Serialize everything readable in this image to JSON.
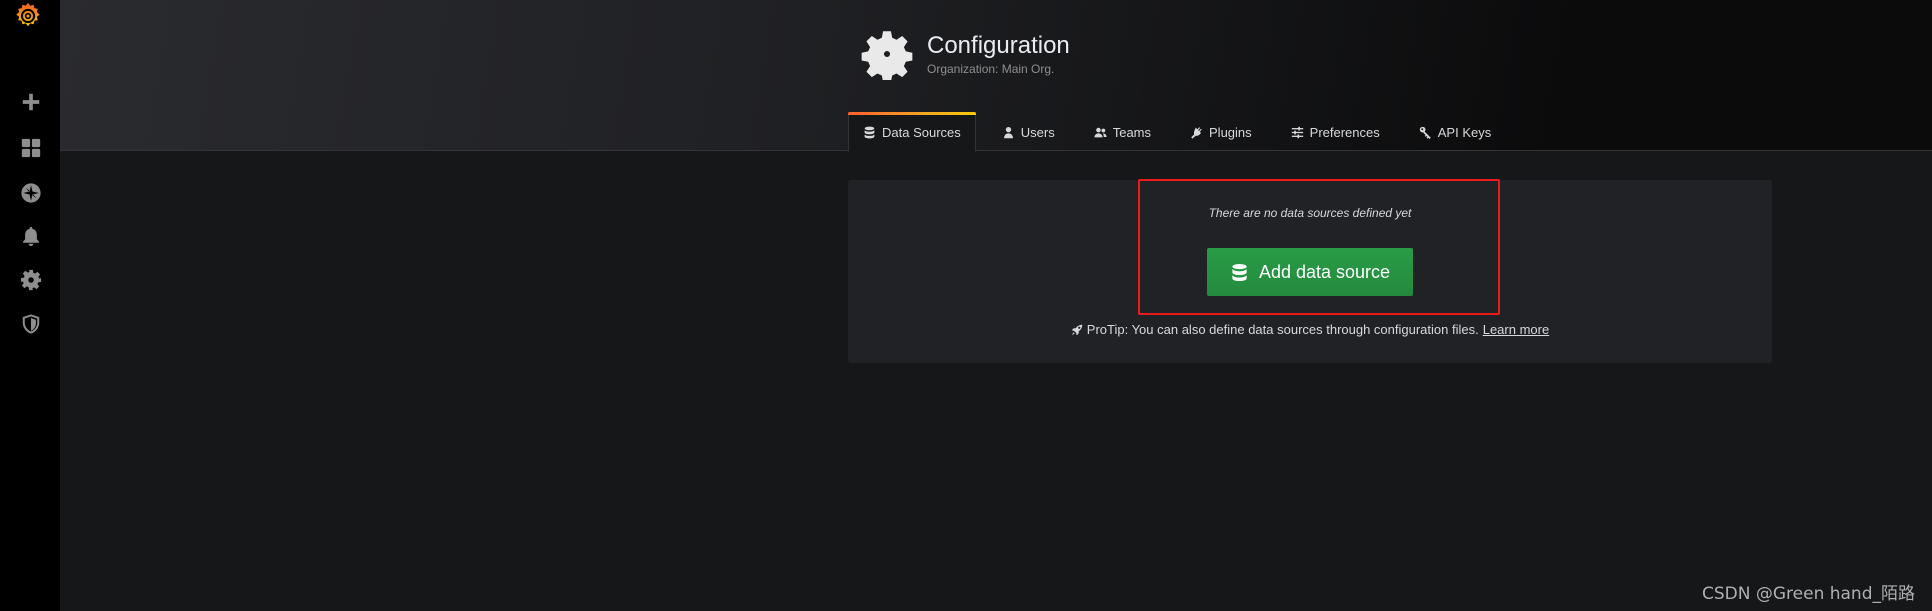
{
  "sidebar": {
    "logo": "grafana-logo",
    "items": [
      {
        "name": "create",
        "icon": "plus-icon"
      },
      {
        "name": "dashboards",
        "icon": "dashboards-grid-icon"
      },
      {
        "name": "explore",
        "icon": "compass-icon"
      },
      {
        "name": "alerting",
        "icon": "bell-icon"
      },
      {
        "name": "configuration",
        "icon": "gear-icon"
      },
      {
        "name": "server-admin",
        "icon": "shield-icon"
      }
    ]
  },
  "header": {
    "icon": "gear-icon",
    "title": "Configuration",
    "subtitle": "Organization: Main Org."
  },
  "tabs": [
    {
      "label": "Data Sources",
      "icon": "database-icon",
      "active": true
    },
    {
      "label": "Users",
      "icon": "user-icon",
      "active": false
    },
    {
      "label": "Teams",
      "icon": "users-icon",
      "active": false
    },
    {
      "label": "Plugins",
      "icon": "plug-icon",
      "active": false
    },
    {
      "label": "Preferences",
      "icon": "sliders-icon",
      "active": false
    },
    {
      "label": "API Keys",
      "icon": "key-icon",
      "active": false
    }
  ],
  "empty_state": {
    "message": "There are no data sources defined yet",
    "button_label": "Add data source",
    "protip": "ProTip: You can also define data sources through configuration files.",
    "learn_more": "Learn more"
  },
  "colors": {
    "accent_green": "#299c46",
    "highlight_red": "#ec1c1c",
    "tab_gradient_start": "#ff5f2e",
    "tab_gradient_end": "#fbca0a"
  },
  "watermark": "CSDN @Green hand_陌路"
}
